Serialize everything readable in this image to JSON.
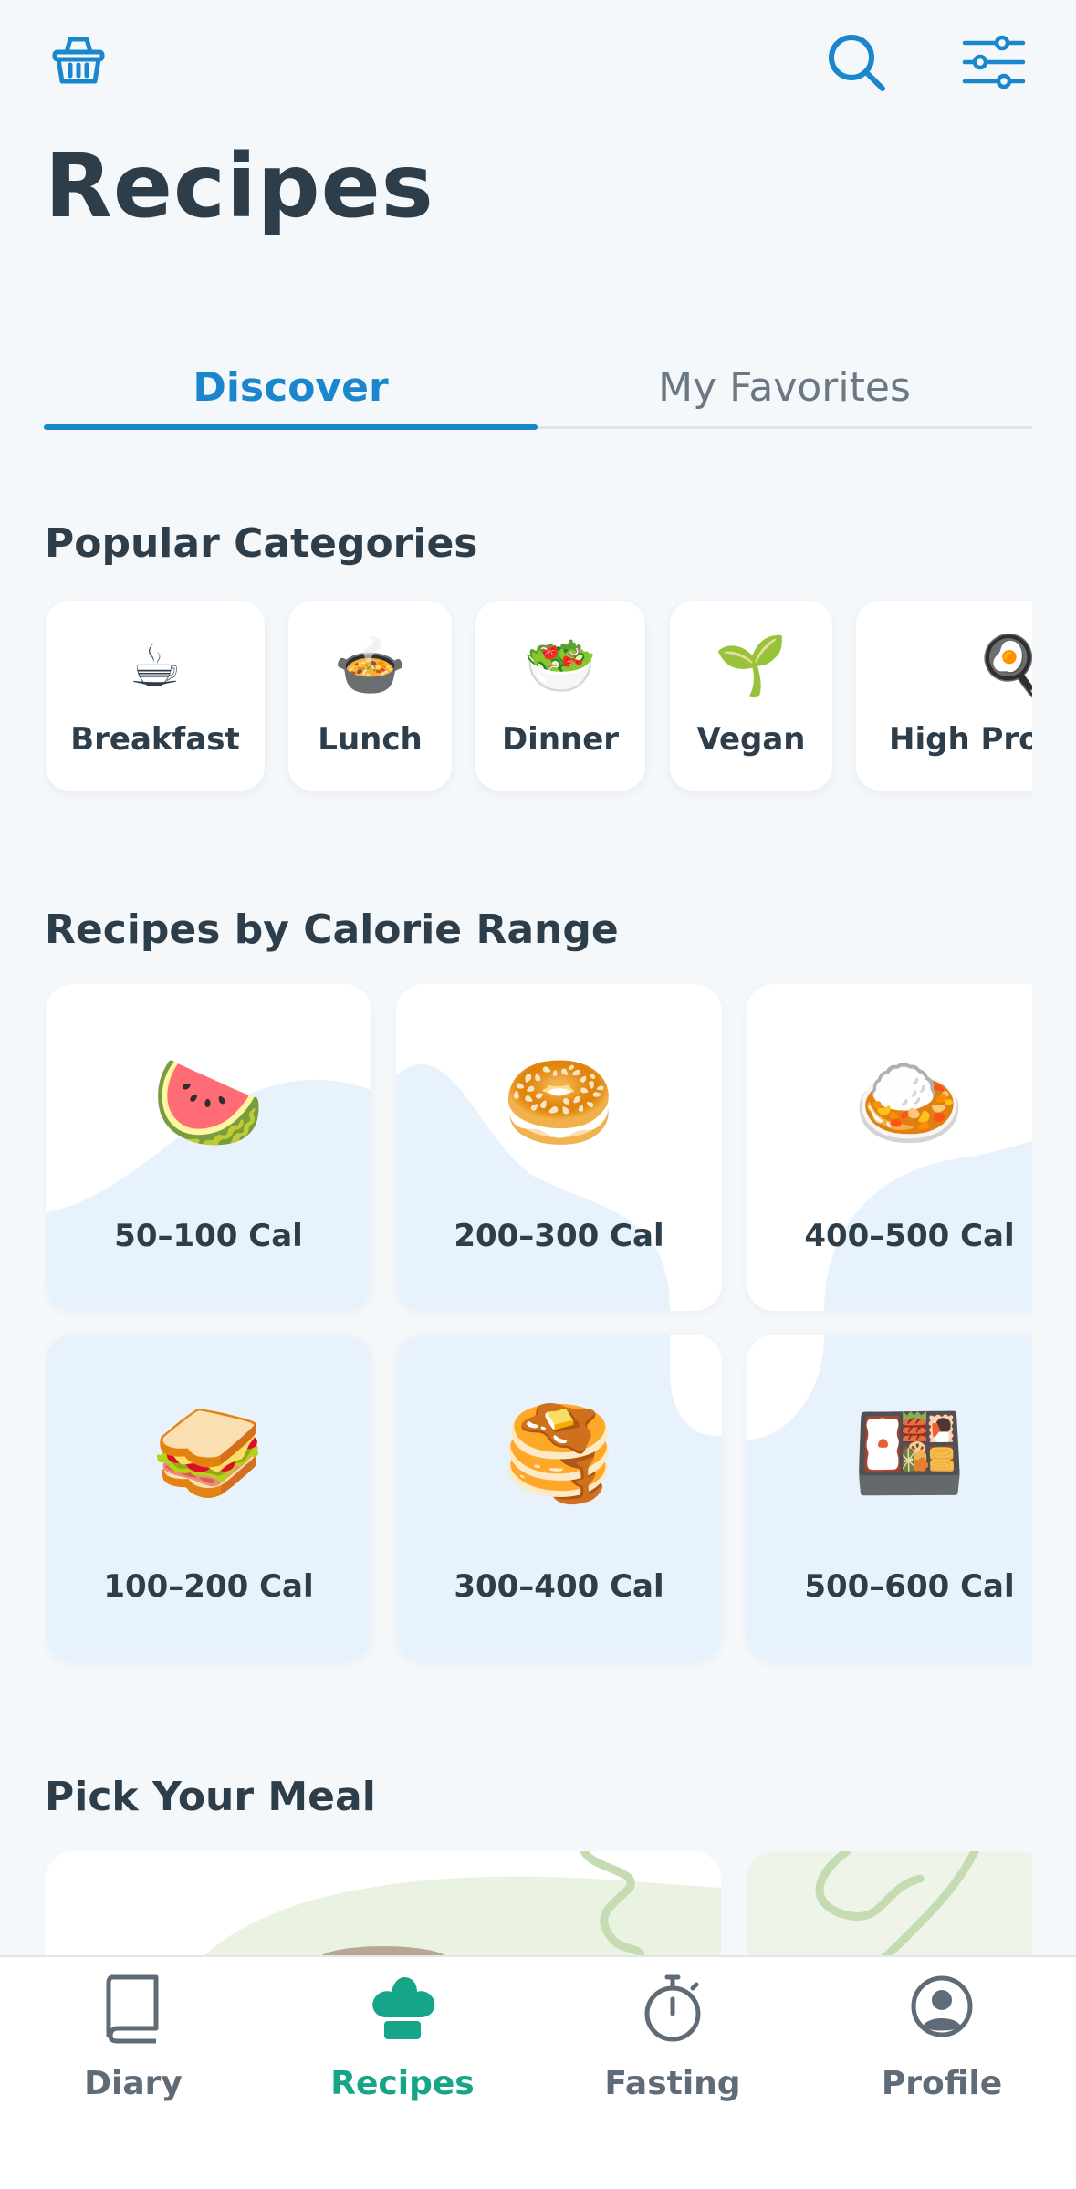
{
  "header": {
    "basket_icon": "basket-icon",
    "search_icon": "search-icon",
    "filter_icon": "sliders-icon",
    "title": "Recipes"
  },
  "tabs": [
    {
      "label": "Discover",
      "active": true
    },
    {
      "label": "My Favorites",
      "active": false
    }
  ],
  "popular_categories": {
    "title": "Popular Categories",
    "items": [
      {
        "label": "Breakfast",
        "emoji": "☕"
      },
      {
        "label": "Lunch",
        "emoji": "🍲"
      },
      {
        "label": "Dinner",
        "emoji": "🥗"
      },
      {
        "label": "Vegan",
        "emoji": "🌱"
      },
      {
        "label": "High Protein",
        "emoji": "🍳"
      }
    ]
  },
  "calorie_ranges": {
    "title": "Recipes by Calorie Range",
    "items": [
      {
        "label": "50–100 Cal",
        "emoji": "🍉"
      },
      {
        "label": "200–300 Cal",
        "emoji": "🥯"
      },
      {
        "label": "400–500 Cal",
        "emoji": "🍛"
      },
      {
        "label": "100–200 Cal",
        "emoji": "🥪"
      },
      {
        "label": "300–400 Cal",
        "emoji": "🥞"
      },
      {
        "label": "500–600 Cal",
        "emoji": "🍱"
      }
    ]
  },
  "pick_meal": {
    "title": "Pick Your Meal"
  },
  "bottom_nav": [
    {
      "label": "Diary",
      "icon": "book-icon",
      "active": false
    },
    {
      "label": "Recipes",
      "icon": "chef-hat-icon",
      "active": true
    },
    {
      "label": "Fasting",
      "icon": "stopwatch-icon",
      "active": false
    },
    {
      "label": "Profile",
      "icon": "user-circle-icon",
      "active": false
    }
  ],
  "colors": {
    "accent_blue": "#1a87cc",
    "accent_green": "#16a589",
    "background": "#f5f8fb",
    "card_blue": "#e8f2fc"
  }
}
